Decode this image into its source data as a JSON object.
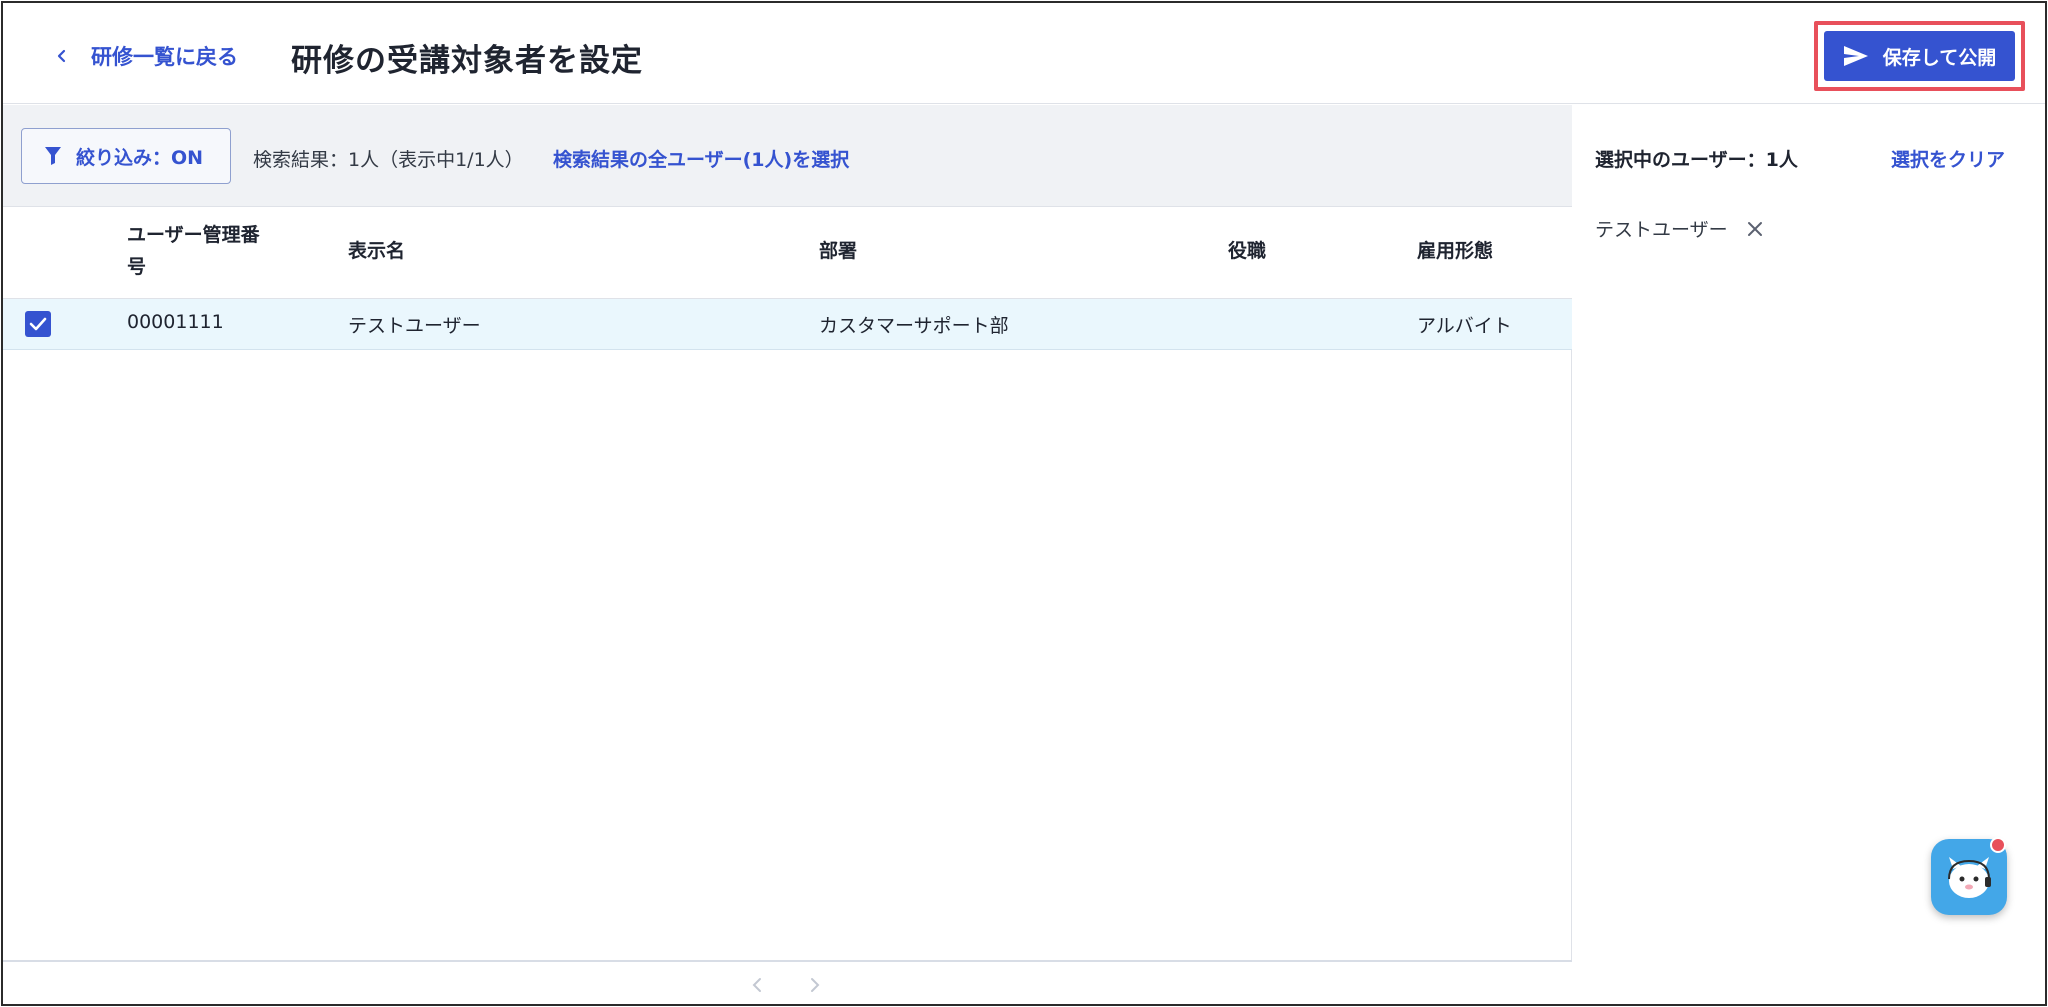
{
  "header": {
    "back_label": "研修一覧に戻る",
    "title": "研修の受講対象者を設定",
    "publish_label": "保存して公開"
  },
  "toolbar": {
    "filter_label": "絞り込み：ON",
    "result_text": "検索結果：1人（表示中1/1人）",
    "select_all_label": "検索結果の全ユーザー(1人)を選択"
  },
  "table": {
    "columns": [
      "ユーザー管理番\n号",
      "表示名",
      "部署",
      "役職",
      "雇用形態"
    ],
    "rows": [
      {
        "checked": true,
        "id": "00001111",
        "name": "テストユーザー",
        "dept": "カスタマーサポート部",
        "position": "",
        "employment": "アルバイト"
      }
    ]
  },
  "side": {
    "selected_count": "選択中のユーザー：1人",
    "clear_label": "選択をクリア",
    "chips": [
      {
        "label": "テストユーザー"
      }
    ]
  },
  "colors": {
    "accent": "#3553d0",
    "highlight_outline": "#e8505b",
    "selected_row": "#eaf7fd",
    "toolbar_bg": "#f0f2f5",
    "chat_fab": "#43a7e8"
  },
  "icons": [
    "chevron-left-icon",
    "send-icon",
    "filter-icon",
    "check-icon",
    "close-icon",
    "chat-support-icon"
  ]
}
